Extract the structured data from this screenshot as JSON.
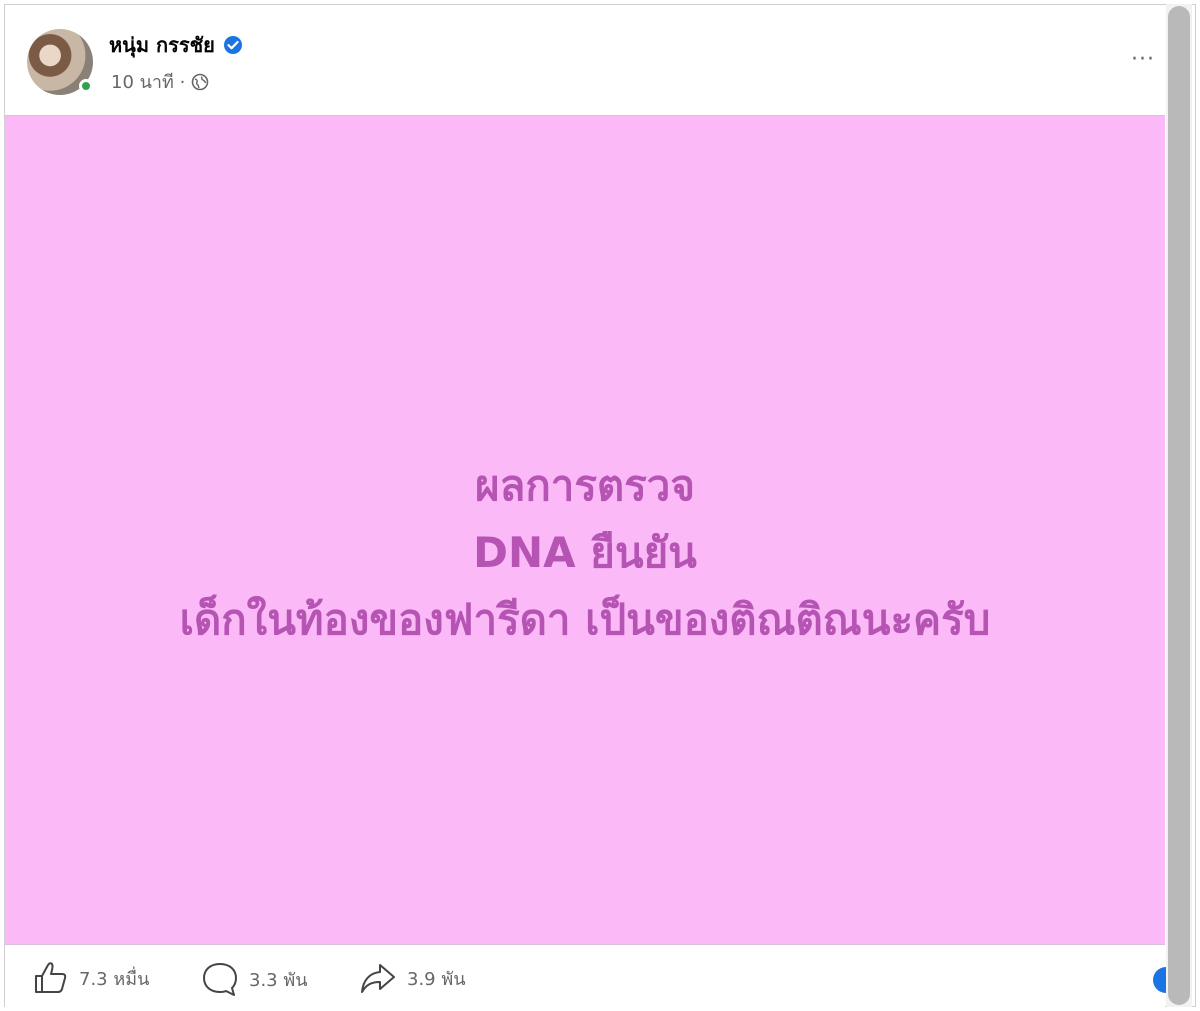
{
  "post": {
    "author_name": "หนุ่ม กรรชัย",
    "timestamp": "10 นาที ·",
    "more_label": "···",
    "text_lines": [
      "ผลการตรวจ",
      "DNA ยืนยัน",
      "เด็กในท้องของฟารีดา เป็นของติณติณนะครับ"
    ],
    "background_color": "#fbb9f8",
    "text_color": "#b654b4"
  },
  "footer": {
    "likes": "7.3 หมื่น",
    "comments": "3.3 พัน",
    "shares": "3.9 พัน"
  },
  "icons": {
    "verified": "verified-badge-icon",
    "privacy": "globe-icon",
    "like": "thumbs-up-icon",
    "comment": "comment-bubble-icon",
    "share": "share-arrow-icon"
  },
  "colors": {
    "verified": "#1b74e4",
    "online": "#31a24c",
    "meta_text": "#65676b"
  }
}
